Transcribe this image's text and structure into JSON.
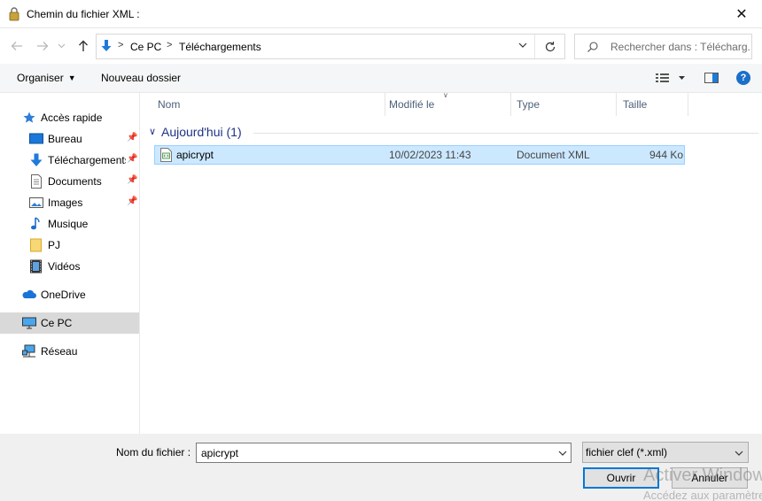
{
  "window": {
    "title": "Chemin du fichier XML :",
    "close_glyph": "✕"
  },
  "navigation": {
    "back_icon": "arrow-left-icon",
    "forward_icon": "arrow-right-icon",
    "recent_icon": "chevron-down-icon",
    "up_icon": "arrow-up-icon",
    "path": [
      "Ce PC",
      "Téléchargements"
    ],
    "separator": ">",
    "search_placeholder": "Rechercher dans : Télécharg..."
  },
  "toolbar": {
    "organize": "Organiser",
    "new_folder": "Nouveau dossier",
    "help": "?"
  },
  "sidebar": {
    "items": [
      {
        "label": "Accès rapide",
        "icon": "star-icon",
        "pinned": false
      },
      {
        "label": "Bureau",
        "icon": "desktop-icon",
        "pinned": true
      },
      {
        "label": "Téléchargements",
        "icon": "downloads-icon",
        "pinned": true
      },
      {
        "label": "Documents",
        "icon": "documents-icon",
        "pinned": true
      },
      {
        "label": "Images",
        "icon": "images-icon",
        "pinned": true
      },
      {
        "label": "Musique",
        "icon": "music-icon",
        "pinned": false
      },
      {
        "label": "PJ",
        "icon": "folder-icon",
        "pinned": false
      },
      {
        "label": "Vidéos",
        "icon": "videos-icon",
        "pinned": false
      },
      {
        "label": "OneDrive",
        "icon": "onedrive-icon",
        "pinned": false
      },
      {
        "label": "Ce PC",
        "icon": "pc-icon",
        "pinned": false,
        "selected": true
      },
      {
        "label": "Réseau",
        "icon": "network-icon",
        "pinned": false
      }
    ],
    "pin_glyph": "📌"
  },
  "columns": {
    "name": "Nom",
    "modified": "Modifié le",
    "type": "Type",
    "size": "Taille"
  },
  "group": {
    "title": "Aujourd'hui (1)",
    "chevron": "∨"
  },
  "files": [
    {
      "name": "apicrypt",
      "modified": "10/02/2023 11:43",
      "type": "Document XML",
      "size": "944 Ko",
      "icon": "xml-file-icon",
      "selected": true
    }
  ],
  "footer": {
    "filename_label": "Nom du fichier :",
    "filename_value": "apicrypt",
    "filter": "fichier clef (*.xml)",
    "open": "Ouvrir",
    "cancel": "Annuler"
  },
  "watermark": {
    "line1": "Activer Windows",
    "line2": "Accédez aux paramètres"
  },
  "colors": {
    "accent": "#0078d7",
    "selection": "#cce8ff",
    "group_title": "#1e3287"
  }
}
